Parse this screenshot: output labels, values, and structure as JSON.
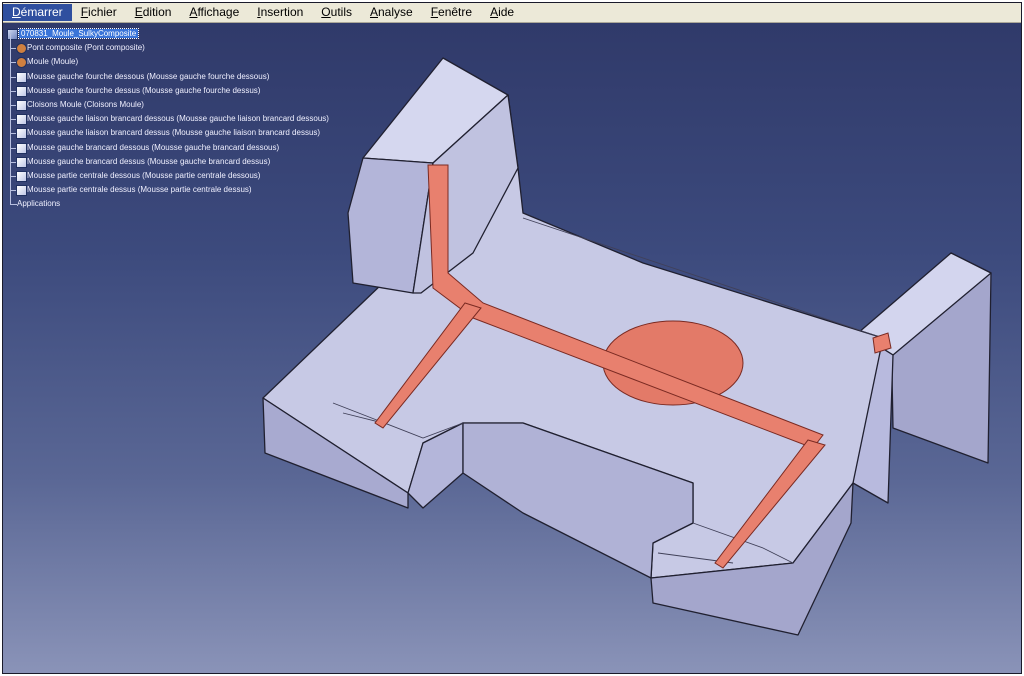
{
  "menu": {
    "items": [
      {
        "label": "Démarrer",
        "active": true
      },
      {
        "label": "Fichier"
      },
      {
        "label": "Edition"
      },
      {
        "label": "Affichage"
      },
      {
        "label": "Insertion"
      },
      {
        "label": "Outils"
      },
      {
        "label": "Analyse"
      },
      {
        "label": "Fenêtre"
      },
      {
        "label": "Aide"
      }
    ]
  },
  "tree": {
    "root": "070831_Moule_SulkyComposite",
    "nodes": [
      "Pont composite (Pont composite)",
      "Moule (Moule)",
      "Mousse gauche fourche dessous (Mousse gauche fourche dessous)",
      "Mousse gauche fourche dessus (Mousse gauche fourche dessus)",
      "Cloisons Moule (Cloisons Moule)",
      "Mousse gauche liaison brancard dessous (Mousse gauche liaison brancard dessous)",
      "Mousse gauche liaison brancard dessus (Mousse gauche liaison brancard dessus)",
      "Mousse gauche brancard dessous (Mousse gauche brancard dessous)",
      "Mousse gauche brancard dessus (Mousse gauche brancard dessus)",
      "Mousse partie centrale dessous (Mousse partie centrale dessous)",
      "Mousse partie centrale dessus (Mousse partie centrale dessus)"
    ],
    "applications": "Applications"
  },
  "colors": {
    "mold_top": "#c9cbe6",
    "mold_side": "#a9abd0",
    "channel": "#e8806e",
    "edge": "#202030"
  }
}
